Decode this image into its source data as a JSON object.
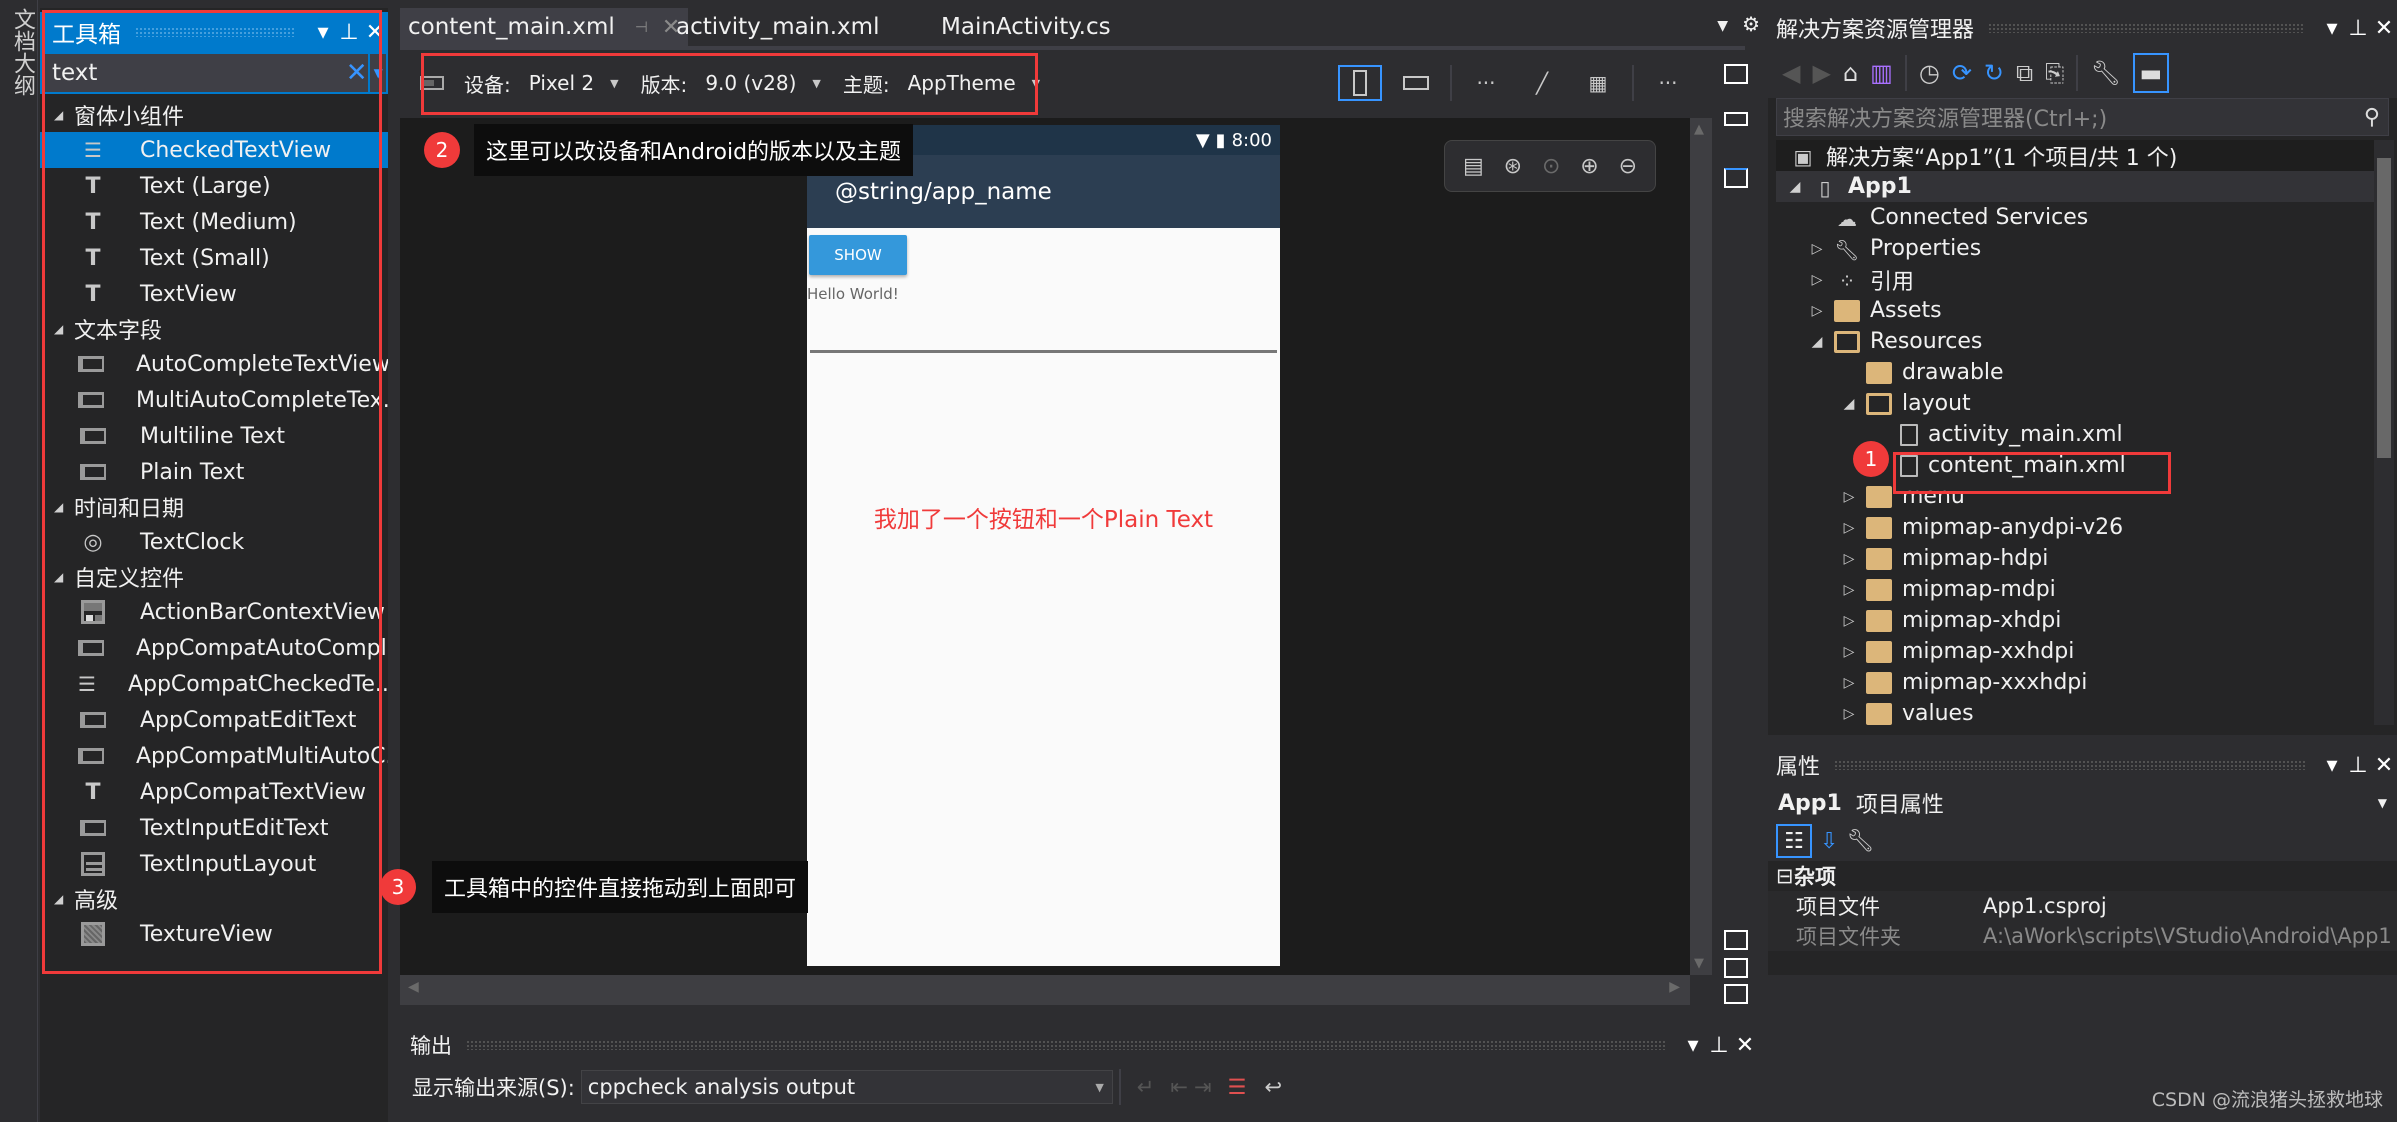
{
  "side_strip": {
    "label": "文档大纲"
  },
  "toolbox": {
    "title": "工具箱",
    "search_value": "text",
    "categories": [
      {
        "label": "窗体小组件",
        "items": [
          {
            "label": "CheckedTextView",
            "icon": "checked-text-icon",
            "selected": true
          },
          {
            "label": "Text (Large)",
            "icon": "text-icon"
          },
          {
            "label": "Text (Medium)",
            "icon": "text-icon"
          },
          {
            "label": "Text (Small)",
            "icon": "text-icon"
          },
          {
            "label": "TextView",
            "icon": "text-icon"
          }
        ]
      },
      {
        "label": "文本字段",
        "items": [
          {
            "label": "AutoCompleteTextView",
            "icon": "edit-text-icon"
          },
          {
            "label": "MultiAutoCompleteTex...",
            "icon": "edit-text-icon"
          },
          {
            "label": "Multiline Text",
            "icon": "edit-text-icon"
          },
          {
            "label": "Plain Text",
            "icon": "edit-text-icon"
          }
        ]
      },
      {
        "label": "时间和日期",
        "items": [
          {
            "label": "TextClock",
            "icon": "clock-icon"
          }
        ]
      },
      {
        "label": "自定义控件",
        "items": [
          {
            "label": "ActionBarContextView",
            "icon": "action-bar-icon"
          },
          {
            "label": "AppCompatAutoCompl...",
            "icon": "edit-text-icon"
          },
          {
            "label": "AppCompatCheckedTe...",
            "icon": "checked-text-icon"
          },
          {
            "label": "AppCompatEditText",
            "icon": "edit-text-icon"
          },
          {
            "label": "AppCompatMultiAutoC...",
            "icon": "edit-text-icon"
          },
          {
            "label": "AppCompatTextView",
            "icon": "text-icon"
          },
          {
            "label": "TextInputEditText",
            "icon": "edit-text-icon"
          },
          {
            "label": "TextInputLayout",
            "icon": "list-layout-icon"
          }
        ]
      },
      {
        "label": "高级",
        "items": [
          {
            "label": "TextureView",
            "icon": "texture-icon"
          }
        ]
      }
    ]
  },
  "editor": {
    "tabs": [
      {
        "label": "content_main.xml",
        "active": true
      },
      {
        "label": "activity_main.xml"
      },
      {
        "label": "MainActivity.cs"
      }
    ],
    "designer_toolbar": {
      "device_label": "设备:",
      "device_value": "Pixel 2",
      "version_label": "版本:",
      "version_value": "9.0 (v28)",
      "theme_label": "主题:",
      "theme_value": "AppTheme"
    },
    "phone": {
      "time": "8:00",
      "app_title": "@string/app_name",
      "button_label": "SHOW",
      "hello_text": "Hello World!"
    }
  },
  "annotations": {
    "note1_badge": "1",
    "note2_badge": "2",
    "note2_text": "这里可以改设备和Android的版本以及主题",
    "note3_badge": "3",
    "note3_text": "工具箱中的控件直接拖动到上面即可",
    "canvas_note": "我加了一个按钮和一个Plain Text",
    "accent_color": "#f03a3a"
  },
  "solution_explorer": {
    "title": "解决方案资源管理器",
    "search_placeholder": "搜索解决方案资源管理器(Ctrl+;)",
    "tree": [
      {
        "label": "解决方案“App1”(1 个项目/共 1 个)",
        "level": 0,
        "expander": "",
        "icon": "solution"
      },
      {
        "label": "App1",
        "level": 0,
        "expander": "open",
        "icon": "android-project",
        "bold": true
      },
      {
        "label": "Connected Services",
        "level": 1,
        "expander": "",
        "icon": "cloud"
      },
      {
        "label": "Properties",
        "level": 1,
        "expander": "closed",
        "icon": "wrench"
      },
      {
        "label": "引用",
        "level": 1,
        "expander": "closed",
        "icon": "references"
      },
      {
        "label": "Assets",
        "level": 1,
        "expander": "closed",
        "icon": "folder"
      },
      {
        "label": "Resources",
        "level": 1,
        "expander": "open",
        "icon": "folder-open"
      },
      {
        "label": "drawable",
        "level": 2,
        "expander": "",
        "icon": "folder"
      },
      {
        "label": "layout",
        "level": 2,
        "expander": "open",
        "icon": "folder-open"
      },
      {
        "label": "activity_main.xml",
        "level": 3,
        "expander": "",
        "icon": "file"
      },
      {
        "label": "content_main.xml",
        "level": 3,
        "expander": "",
        "icon": "file",
        "highlighted": true
      },
      {
        "label": "menu",
        "level": 2,
        "expander": "closed",
        "icon": "folder"
      },
      {
        "label": "mipmap-anydpi-v26",
        "level": 2,
        "expander": "closed",
        "icon": "folder"
      },
      {
        "label": "mipmap-hdpi",
        "level": 2,
        "expander": "closed",
        "icon": "folder"
      },
      {
        "label": "mipmap-mdpi",
        "level": 2,
        "expander": "closed",
        "icon": "folder"
      },
      {
        "label": "mipmap-xhdpi",
        "level": 2,
        "expander": "closed",
        "icon": "folder"
      },
      {
        "label": "mipmap-xxhdpi",
        "level": 2,
        "expander": "closed",
        "icon": "folder"
      },
      {
        "label": "mipmap-xxxhdpi",
        "level": 2,
        "expander": "closed",
        "icon": "folder"
      },
      {
        "label": "values",
        "level": 2,
        "expander": "closed",
        "icon": "folder"
      }
    ]
  },
  "properties": {
    "title": "属性",
    "object_name": "App1",
    "object_type": "项目属性",
    "section": "杂项",
    "rows": [
      {
        "key": "项目文件",
        "value": "App1.csproj"
      },
      {
        "key": "项目文件夹",
        "value": "A:\\aWork\\scripts\\VStudio\\Android\\App1"
      }
    ]
  },
  "output": {
    "title": "输出",
    "source_label": "显示输出来源(S):",
    "source_value": "cppcheck analysis output"
  },
  "watermark": "CSDN @流浪猪头拯救地球"
}
